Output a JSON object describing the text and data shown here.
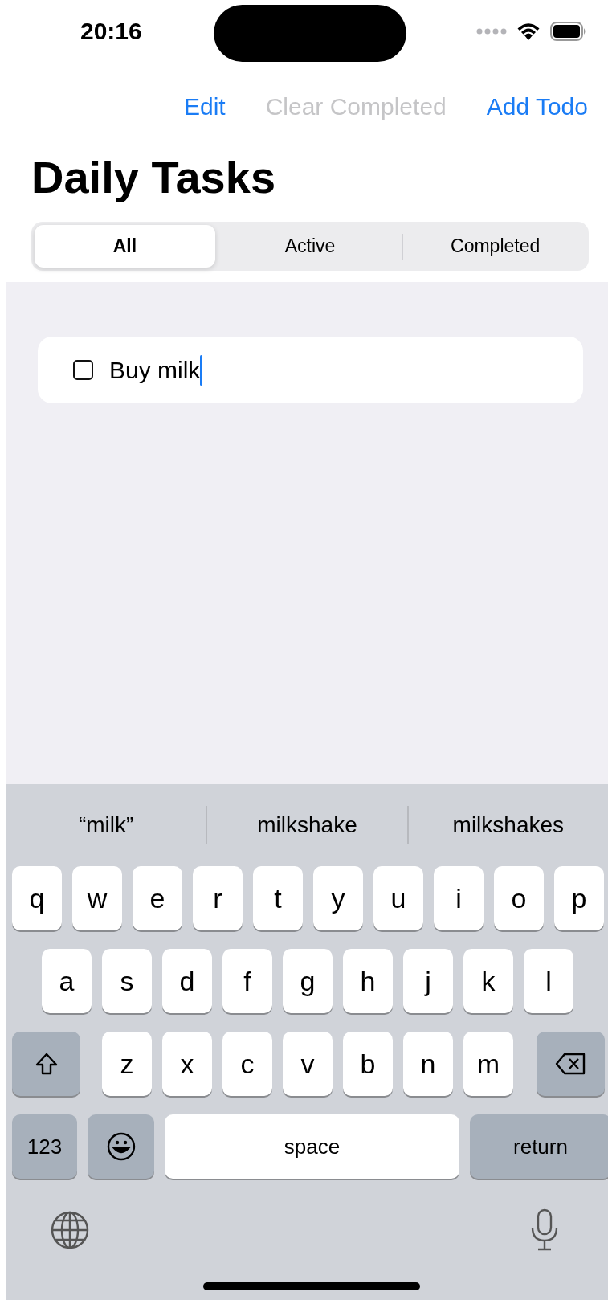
{
  "status_bar": {
    "time": "20:16"
  },
  "nav_buttons": [
    {
      "label": "Edit",
      "disabled": false
    },
    {
      "label": "Clear Completed",
      "disabled": true
    },
    {
      "label": "Add Todo",
      "disabled": false
    }
  ],
  "title": "Daily Tasks",
  "filter_tabs": [
    {
      "label": "All",
      "selected": true
    },
    {
      "label": "Active",
      "selected": false
    },
    {
      "label": "Completed",
      "selected": false
    }
  ],
  "todos": [
    {
      "text": "Buy milk",
      "checked": false,
      "editing": true
    }
  ],
  "keyboard": {
    "suggestions": [
      "“milk”",
      "milkshake",
      "milkshakes"
    ],
    "rows": [
      [
        {
          "kind": "letter",
          "label": "q"
        },
        {
          "kind": "letter",
          "label": "w"
        },
        {
          "kind": "letter",
          "label": "e"
        },
        {
          "kind": "letter",
          "label": "r"
        },
        {
          "kind": "letter",
          "label": "t"
        },
        {
          "kind": "letter",
          "label": "y"
        },
        {
          "kind": "letter",
          "label": "u"
        },
        {
          "kind": "letter",
          "label": "i"
        },
        {
          "kind": "letter",
          "label": "o"
        },
        {
          "kind": "letter",
          "label": "p"
        }
      ],
      [
        {
          "kind": "letter",
          "label": "a"
        },
        {
          "kind": "letter",
          "label": "s"
        },
        {
          "kind": "letter",
          "label": "d"
        },
        {
          "kind": "letter",
          "label": "f"
        },
        {
          "kind": "letter",
          "label": "g"
        },
        {
          "kind": "letter",
          "label": "h"
        },
        {
          "kind": "letter",
          "label": "j"
        },
        {
          "kind": "letter",
          "label": "k"
        },
        {
          "kind": "letter",
          "label": "l"
        }
      ],
      [
        {
          "kind": "shift"
        },
        {
          "kind": "letter",
          "label": "z"
        },
        {
          "kind": "letter",
          "label": "x"
        },
        {
          "kind": "letter",
          "label": "c"
        },
        {
          "kind": "letter",
          "label": "v"
        },
        {
          "kind": "letter",
          "label": "b"
        },
        {
          "kind": "letter",
          "label": "n"
        },
        {
          "kind": "letter",
          "label": "m"
        },
        {
          "kind": "delete"
        }
      ]
    ],
    "bottom_row": [
      {
        "kind": "mode",
        "label": "123"
      },
      {
        "kind": "emoji"
      },
      {
        "kind": "space",
        "label": "space"
      },
      {
        "kind": "return",
        "label": "return"
      }
    ]
  }
}
